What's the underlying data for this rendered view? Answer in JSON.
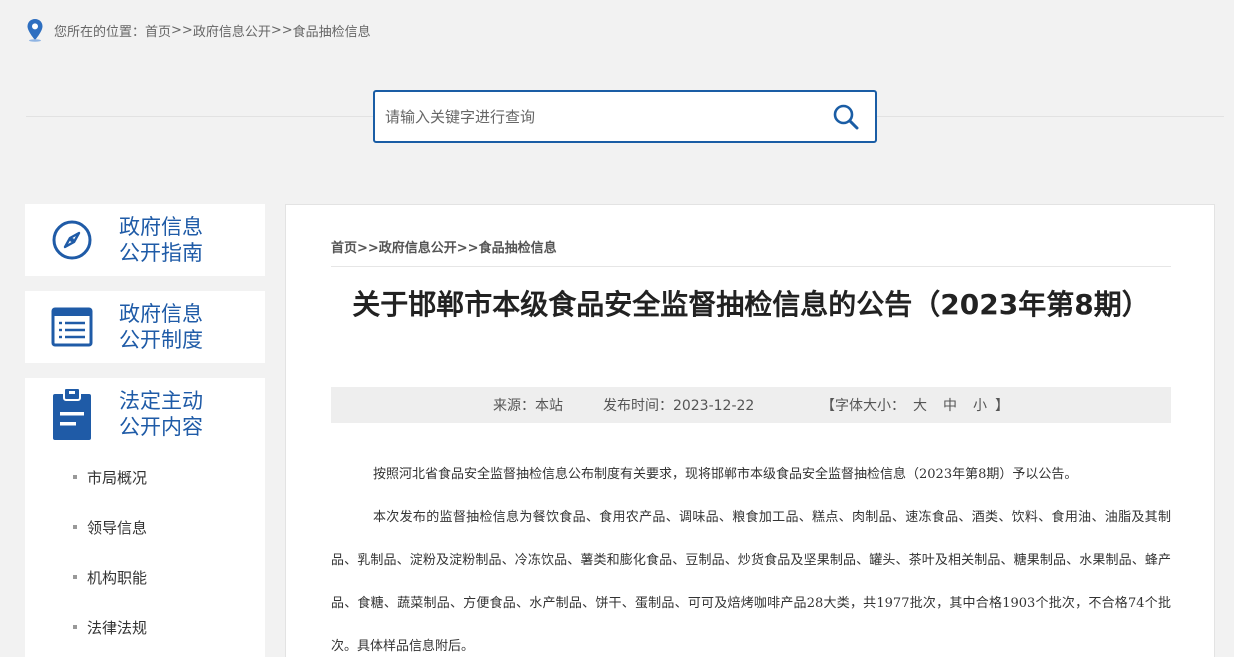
{
  "location": {
    "label": "您所在的位置：",
    "crumbs": [
      "首页",
      ">>",
      "政府信息公开",
      ">>",
      "食品抽检信息"
    ]
  },
  "search": {
    "placeholder": "请输入关键字进行查询",
    "value": ""
  },
  "sidebar": {
    "cards": [
      {
        "line1": "政府信息",
        "line2": "公开指南",
        "icon": "compass-icon"
      },
      {
        "line1": "政府信息",
        "line2": "公开制度",
        "icon": "document-list-icon"
      },
      {
        "line1": "法定主动",
        "line2": "公开内容",
        "icon": "clipboard-icon"
      }
    ],
    "items": [
      "市局概况",
      "领导信息",
      "机构职能",
      "法律法规"
    ]
  },
  "article": {
    "breadcrumb": "首页>>政府信息公开>>食品抽检信息",
    "title": "关于邯郸市本级食品安全监督抽检信息的公告（2023年第8期）",
    "source": "来源：本站",
    "publish_time": "发布时间：2023-12-22",
    "font_size_label": "【字体大小：",
    "font_large": "大",
    "font_medium": "中",
    "font_small": "小",
    "font_size_end": "】",
    "paragraphs": [
      "按照河北省食品安全监督抽检信息公布制度有关要求，现将邯郸市本级食品安全监督抽检信息（2023年第8期）予以公告。",
      "本次发布的监督抽检信息为餐饮食品、食用农产品、调味品、粮食加工品、糕点、肉制品、速冻食品、酒类、饮料、食用油、油脂及其制品、乳制品、淀粉及淀粉制品、冷冻饮品、薯类和膨化食品、豆制品、炒货食品及坚果制品、罐头、茶叶及相关制品、糖果制品、水果制品、蜂产品、食糖、蔬菜制品、方便食品、水产制品、饼干、蛋制品、可可及焙烤咖啡产品28大类，共1977批次，其中合格1903个批次，不合格74个批次。具体样品信息附后。"
    ]
  },
  "colors": {
    "brand_blue": "#1f5ba7",
    "search_border": "#1a5da5",
    "page_bg": "#f2f2f2"
  }
}
